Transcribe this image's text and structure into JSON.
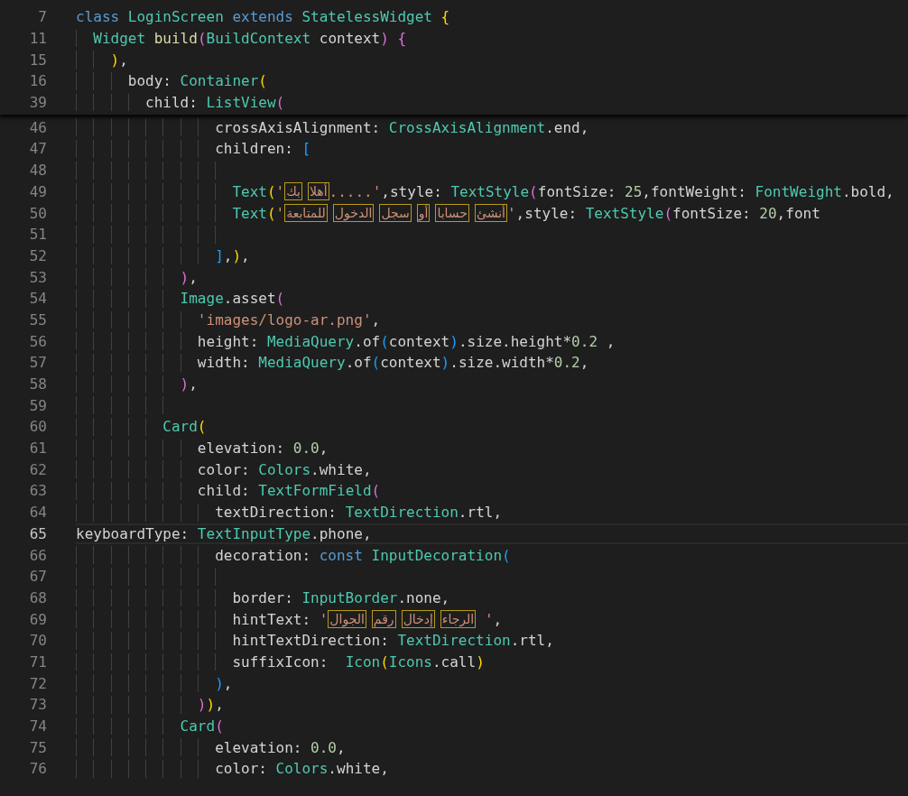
{
  "sticky_lines": [
    {
      "number": "7",
      "current": false,
      "tokens": [
        {
          "kind": "keyword",
          "text": "class "
        },
        {
          "kind": "type",
          "text": "LoginScreen "
        },
        {
          "kind": "keyword",
          "text": "extends "
        },
        {
          "kind": "type",
          "text": "StatelessWidget "
        },
        {
          "kind": "bracket1",
          "text": "{"
        }
      ]
    },
    {
      "number": "11",
      "current": false,
      "tokens": [
        {
          "kind": "type",
          "text": "  Widget "
        },
        {
          "kind": "func",
          "text": "build"
        },
        {
          "kind": "bracket2",
          "text": "("
        },
        {
          "kind": "type",
          "text": "BuildContext"
        },
        {
          "kind": "plain",
          "text": " context"
        },
        {
          "kind": "bracket2",
          "text": ")"
        },
        {
          "kind": "bracket2",
          "text": " {"
        }
      ]
    },
    {
      "number": "15",
      "current": false,
      "tokens": [
        {
          "kind": "bracket1",
          "text": "    )"
        },
        {
          "kind": "plain",
          "text": ","
        }
      ]
    },
    {
      "number": "16",
      "current": false,
      "tokens": [
        {
          "kind": "plain",
          "text": "      body: "
        },
        {
          "kind": "type",
          "text": "Container"
        },
        {
          "kind": "bracket1",
          "text": "("
        }
      ]
    },
    {
      "number": "39",
      "current": false,
      "tokens": [
        {
          "kind": "plain",
          "text": "        child: "
        },
        {
          "kind": "type",
          "text": "ListView"
        },
        {
          "kind": "bracket2",
          "text": "("
        }
      ]
    }
  ],
  "lines": [
    {
      "number": "46",
      "current": false,
      "tokens": [
        {
          "kind": "plain",
          "text": "                crossAxisAlignment: "
        },
        {
          "kind": "type",
          "text": "CrossAxisAlignment"
        },
        {
          "kind": "plain",
          "text": ".end,"
        }
      ]
    },
    {
      "number": "47",
      "current": false,
      "tokens": [
        {
          "kind": "plain",
          "text": "                children: "
        },
        {
          "kind": "bracket3",
          "text": "["
        }
      ]
    },
    {
      "number": "48",
      "current": false
    },
    {
      "number": "49",
      "current": false,
      "tokens": [
        {
          "kind": "type",
          "text": "                  Text"
        },
        {
          "kind": "bracket1",
          "text": "("
        },
        {
          "kind": "string",
          "text": "'"
        },
        {
          "kind": "arabic",
          "text": "بك"
        },
        {
          "kind": "arabic",
          "text": "أهلا"
        },
        {
          "kind": "string",
          "text": ".....'"
        },
        {
          "kind": "plain",
          "text": ",style: "
        },
        {
          "kind": "type",
          "text": "TextStyle"
        },
        {
          "kind": "bracket2",
          "text": "("
        },
        {
          "kind": "plain",
          "text": "fontSize: "
        },
        {
          "kind": "number",
          "text": "25"
        },
        {
          "kind": "plain",
          "text": ",fontWeight: "
        },
        {
          "kind": "type",
          "text": "FontWeight"
        },
        {
          "kind": "plain",
          "text": ".bold,"
        }
      ]
    },
    {
      "number": "50",
      "current": false,
      "tokens": [
        {
          "kind": "type",
          "text": "                  Text"
        },
        {
          "kind": "bracket1",
          "text": "("
        },
        {
          "kind": "string",
          "text": "'"
        },
        {
          "kind": "arabic",
          "text": "للمتابعة"
        },
        {
          "kind": "arabic",
          "text": "الدخول"
        },
        {
          "kind": "arabic",
          "text": "سجل"
        },
        {
          "kind": "arabic",
          "text": "أو"
        },
        {
          "kind": "arabic",
          "text": "حسابا"
        },
        {
          "kind": "arabic",
          "text": "أنشئ"
        },
        {
          "kind": "string",
          "text": "'"
        },
        {
          "kind": "plain",
          "text": ",style: "
        },
        {
          "kind": "type",
          "text": "TextStyle"
        },
        {
          "kind": "bracket2",
          "text": "("
        },
        {
          "kind": "plain",
          "text": "fontSize: "
        },
        {
          "kind": "number",
          "text": "20"
        },
        {
          "kind": "plain",
          "text": ",font"
        }
      ]
    },
    {
      "number": "51",
      "current": false
    },
    {
      "number": "52",
      "current": false,
      "tokens": [
        {
          "kind": "bracket3",
          "text": "                ]"
        },
        {
          "kind": "plain",
          "text": ","
        },
        {
          "kind": "bracket1",
          "text": ")"
        },
        {
          "kind": "plain",
          "text": ","
        }
      ]
    },
    {
      "number": "53",
      "current": false,
      "tokens": [
        {
          "kind": "bracket2",
          "text": "            )"
        },
        {
          "kind": "plain",
          "text": ","
        }
      ]
    },
    {
      "number": "54",
      "current": false,
      "tokens": [
        {
          "kind": "type",
          "text": "            Image"
        },
        {
          "kind": "plain",
          "text": ".asset"
        },
        {
          "kind": "bracket2",
          "text": "("
        }
      ]
    },
    {
      "number": "55",
      "current": false,
      "tokens": [
        {
          "kind": "string",
          "text": "              'images/logo-ar.png'"
        },
        {
          "kind": "plain",
          "text": ","
        }
      ]
    },
    {
      "number": "56",
      "current": false,
      "tokens": [
        {
          "kind": "plain",
          "text": "              height: "
        },
        {
          "kind": "type",
          "text": "MediaQuery"
        },
        {
          "kind": "plain",
          "text": ".of"
        },
        {
          "kind": "bracket3",
          "text": "("
        },
        {
          "kind": "plain",
          "text": "context"
        },
        {
          "kind": "bracket3",
          "text": ")"
        },
        {
          "kind": "plain",
          "text": ".size.height*"
        },
        {
          "kind": "number",
          "text": "0.2"
        },
        {
          "kind": "plain",
          "text": " ,"
        }
      ]
    },
    {
      "number": "57",
      "current": false,
      "tokens": [
        {
          "kind": "plain",
          "text": "              width: "
        },
        {
          "kind": "type",
          "text": "MediaQuery"
        },
        {
          "kind": "plain",
          "text": ".of"
        },
        {
          "kind": "bracket3",
          "text": "("
        },
        {
          "kind": "plain",
          "text": "context"
        },
        {
          "kind": "bracket3",
          "text": ")"
        },
        {
          "kind": "plain",
          "text": ".size.width*"
        },
        {
          "kind": "number",
          "text": "0.2"
        },
        {
          "kind": "plain",
          "text": ","
        }
      ]
    },
    {
      "number": "58",
      "current": false,
      "tokens": [
        {
          "kind": "bracket2",
          "text": "            )"
        },
        {
          "kind": "plain",
          "text": ","
        }
      ]
    },
    {
      "number": "59",
      "current": false
    },
    {
      "number": "60",
      "current": false,
      "tokens": [
        {
          "kind": "type",
          "text": "          Card"
        },
        {
          "kind": "bracket1",
          "text": "("
        }
      ]
    },
    {
      "number": "61",
      "current": false,
      "tokens": [
        {
          "kind": "plain",
          "text": "              elevation: "
        },
        {
          "kind": "number",
          "text": "0.0"
        },
        {
          "kind": "plain",
          "text": ","
        }
      ]
    },
    {
      "number": "62",
      "current": false,
      "tokens": [
        {
          "kind": "plain",
          "text": "              color: "
        },
        {
          "kind": "type",
          "text": "Colors"
        },
        {
          "kind": "plain",
          "text": ".white,"
        }
      ]
    },
    {
      "number": "63",
      "current": false,
      "tokens": [
        {
          "kind": "plain",
          "text": "              child: "
        },
        {
          "kind": "type",
          "text": "TextFormField"
        },
        {
          "kind": "bracket2",
          "text": "("
        }
      ]
    },
    {
      "number": "64",
      "current": false,
      "tokens": [
        {
          "kind": "plain",
          "text": "                textDirection: "
        },
        {
          "kind": "type",
          "text": "TextDirection"
        },
        {
          "kind": "plain",
          "text": ".rtl,"
        }
      ]
    },
    {
      "number": "65",
      "current": true,
      "tokens": [
        {
          "kind": "plain",
          "text": "keyboardType: "
        },
        {
          "kind": "type",
          "text": "TextInputType"
        },
        {
          "kind": "plain",
          "text": ".phone,"
        }
      ]
    },
    {
      "number": "66",
      "current": false,
      "tokens": [
        {
          "kind": "plain",
          "text": "                decoration: "
        },
        {
          "kind": "keyword",
          "text": "const "
        },
        {
          "kind": "type",
          "text": "InputDecoration"
        },
        {
          "kind": "bracket3",
          "text": "("
        }
      ]
    },
    {
      "number": "67",
      "current": false
    },
    {
      "number": "68",
      "current": false,
      "tokens": [
        {
          "kind": "plain",
          "text": "                  border: "
        },
        {
          "kind": "type",
          "text": "InputBorder"
        },
        {
          "kind": "plain",
          "text": ".none,"
        }
      ]
    },
    {
      "number": "69",
      "current": false,
      "tokens": [
        {
          "kind": "plain",
          "text": "                  hintText: "
        },
        {
          "kind": "string",
          "text": "'"
        },
        {
          "kind": "arabic",
          "text": "الجوال"
        },
        {
          "kind": "arabic",
          "text": "رقم"
        },
        {
          "kind": "arabic",
          "text": "إدخال"
        },
        {
          "kind": "arabic",
          "text": "الرجاء"
        },
        {
          "kind": "string",
          "text": " '"
        },
        {
          "kind": "plain",
          "text": ","
        }
      ]
    },
    {
      "number": "70",
      "current": false,
      "tokens": [
        {
          "kind": "plain",
          "text": "                  hintTextDirection: "
        },
        {
          "kind": "type",
          "text": "TextDirection"
        },
        {
          "kind": "plain",
          "text": ".rtl,"
        }
      ]
    },
    {
      "number": "71",
      "current": false,
      "tokens": [
        {
          "kind": "plain",
          "text": "                  suffixIcon:  "
        },
        {
          "kind": "type",
          "text": "Icon"
        },
        {
          "kind": "bracket1",
          "text": "("
        },
        {
          "kind": "type",
          "text": "Icons"
        },
        {
          "kind": "plain",
          "text": ".call"
        },
        {
          "kind": "bracket1",
          "text": ")"
        }
      ]
    },
    {
      "number": "72",
      "current": false,
      "tokens": [
        {
          "kind": "bracket3",
          "text": "                )"
        },
        {
          "kind": "plain",
          "text": ","
        }
      ]
    },
    {
      "number": "73",
      "current": false,
      "tokens": [
        {
          "kind": "bracket2",
          "text": "              )"
        },
        {
          "kind": "bracket1",
          "text": ")"
        },
        {
          "kind": "plain",
          "text": ","
        }
      ]
    },
    {
      "number": "74",
      "current": false,
      "tokens": [
        {
          "kind": "type",
          "text": "            Card"
        },
        {
          "kind": "bracket2",
          "text": "("
        }
      ]
    },
    {
      "number": "75",
      "current": false,
      "tokens": [
        {
          "kind": "plain",
          "text": "                elevation: "
        },
        {
          "kind": "number",
          "text": "0.0"
        },
        {
          "kind": "plain",
          "text": ","
        }
      ]
    },
    {
      "number": "76",
      "current": false,
      "tokens": [
        {
          "kind": "plain",
          "text": "                color: "
        },
        {
          "kind": "type",
          "text": "Colors"
        },
        {
          "kind": "plain",
          "text": ".white,"
        }
      ]
    }
  ]
}
